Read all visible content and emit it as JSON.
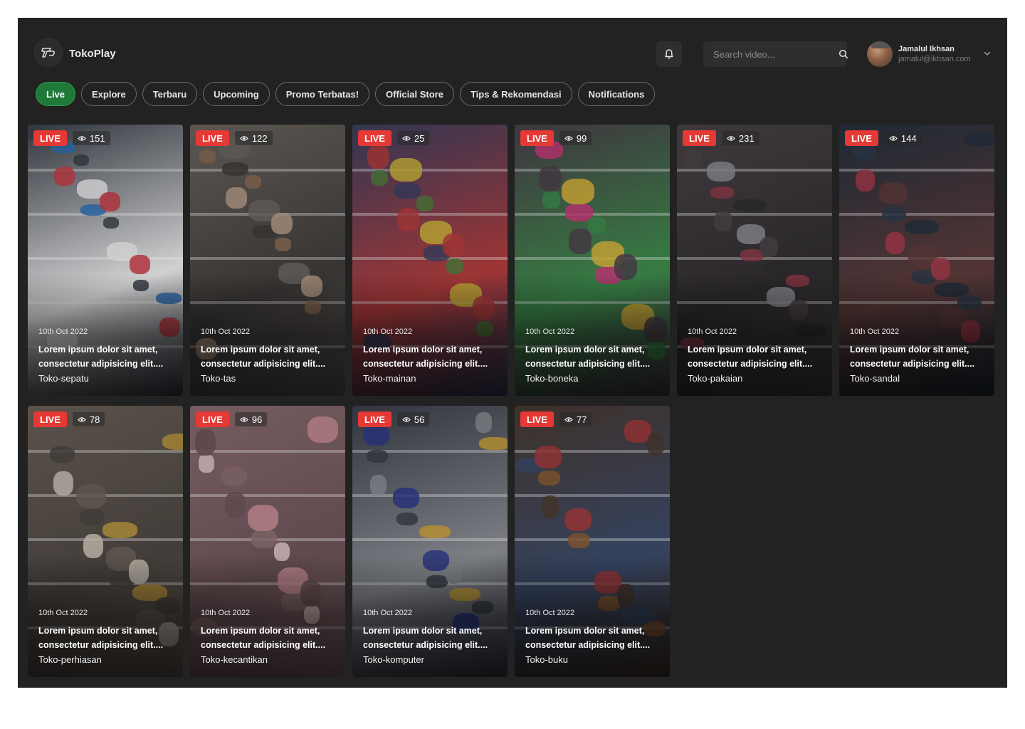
{
  "app": {
    "name": "TokoPlay",
    "accent": "#1f7a3a",
    "live_color": "#e53935"
  },
  "header": {
    "search_placeholder": "Search video...",
    "user": {
      "name": "Jamalul Ikhsan",
      "email": "jamalul@ikhsan.com"
    }
  },
  "tabs": [
    {
      "label": "Live",
      "active": true
    },
    {
      "label": "Explore"
    },
    {
      "label": "Terbaru"
    },
    {
      "label": "Upcoming"
    },
    {
      "label": "Promo Terbatas!"
    },
    {
      "label": "Official Store"
    },
    {
      "label": "Tips & Rekomendasi"
    },
    {
      "label": "Notifications"
    }
  ],
  "videos": [
    {
      "badge": "LIVE",
      "views": "151",
      "date": "10th Oct 2022",
      "title": "Lorem ipsum dolor sit amet, consectetur adipisicing elit....",
      "store": "Toko-sepatu",
      "palette": [
        "#3a3f48",
        "#c63b45",
        "#2f6fb3",
        "#e9e9ea"
      ]
    },
    {
      "badge": "LIVE",
      "views": "122",
      "date": "10th Oct 2022",
      "title": "Lorem ipsum dolor sit amet, consectetur adipisicing elit....",
      "store": "Toko-tas",
      "palette": [
        "#6b6560",
        "#8a6a55",
        "#b49a86",
        "#3d3a38"
      ]
    },
    {
      "badge": "LIVE",
      "views": "25",
      "date": "10th Oct 2022",
      "title": "Lorem ipsum dolor sit amet, consectetur adipisicing elit....",
      "store": "Toko-mainan",
      "palette": [
        "#3b4060",
        "#c9b23a",
        "#4f7a3c",
        "#b03b3b"
      ]
    },
    {
      "badge": "LIVE",
      "views": "99",
      "date": "10th Oct 2022",
      "title": "Lorem ipsum dolor sit amet, consectetur adipisicing elit....",
      "store": "Toko-boneka",
      "palette": [
        "#4a3f4a",
        "#c83a7a",
        "#d8b13a",
        "#3c8a4a"
      ]
    },
    {
      "badge": "LIVE",
      "views": "231",
      "date": "10th Oct 2022",
      "title": "Lorem ipsum dolor sit amet, consectetur adipisicing elit....",
      "store": "Toko-pakaian",
      "palette": [
        "#4a4347",
        "#8c3a4a",
        "#8a8d93",
        "#2e2b2e"
      ]
    },
    {
      "badge": "LIVE",
      "views": "144",
      "date": "10th Oct 2022",
      "title": "Lorem ipsum dolor sit amet, consectetur adipisicing elit....",
      "store": "Toko-sandal",
      "palette": [
        "#24303d",
        "#a33a4a",
        "#2d3a4a",
        "#5c3a3a"
      ]
    },
    {
      "badge": "LIVE",
      "views": "78",
      "date": "10th Oct 2022",
      "title": "Lorem ipsum dolor sit amet, consectetur adipisicing elit....",
      "store": "Toko-perhiasan",
      "palette": [
        "#6a6058",
        "#b8973e",
        "#c9c2b5",
        "#4a4440"
      ]
    },
    {
      "badge": "LIVE",
      "views": "96",
      "date": "10th Oct 2022",
      "title": "Lorem ipsum dolor sit amet, consectetur adipisicing elit....",
      "store": "Toko-kecantikan",
      "palette": [
        "#8a6c70",
        "#c98e96",
        "#e0c6c8",
        "#6a5256"
      ]
    },
    {
      "badge": "LIVE",
      "views": "56",
      "date": "10th Oct 2022",
      "title": "Lorem ipsum dolor sit amet, consectetur adipisicing elit....",
      "store": "Toko-komputer",
      "palette": [
        "#3a3e48",
        "#2d3a8a",
        "#c9a03a",
        "#8a8d93"
      ]
    },
    {
      "badge": "LIVE",
      "views": "77",
      "date": "10th Oct 2022",
      "title": "Lorem ipsum dolor sit amet, consectetur adipisicing elit....",
      "store": "Toko-buku",
      "palette": [
        "#4a3a30",
        "#8a5a34",
        "#a33a3a",
        "#3a4a6a"
      ]
    }
  ]
}
